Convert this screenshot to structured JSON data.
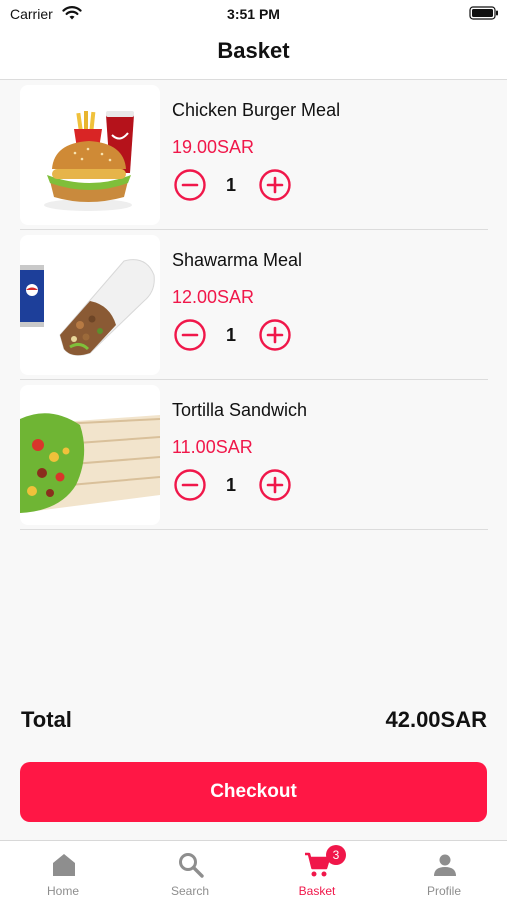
{
  "status_bar": {
    "carrier": "Carrier",
    "time": "3:51 PM"
  },
  "header": {
    "title": "Basket"
  },
  "items": [
    {
      "name": "Chicken Burger Meal",
      "price": "19.00SAR",
      "quantity": "1",
      "image": "chicken-burger-meal-photo"
    },
    {
      "name": "Shawarma Meal",
      "price": "12.00SAR",
      "quantity": "1",
      "image": "shawarma-meal-photo"
    },
    {
      "name": "Tortilla Sandwich",
      "price": "11.00SAR",
      "quantity": "1",
      "image": "tortilla-sandwich-photo"
    }
  ],
  "summary": {
    "total_label": "Total",
    "total_value": "42.00SAR"
  },
  "checkout": {
    "label": "Checkout"
  },
  "tab_bar": {
    "tabs": [
      {
        "label": "Home",
        "icon": "home-icon",
        "active": false
      },
      {
        "label": "Search",
        "icon": "search-icon",
        "active": false
      },
      {
        "label": "Basket",
        "icon": "cart-icon",
        "active": true,
        "badge": "3"
      },
      {
        "label": "Profile",
        "icon": "person-icon",
        "active": false
      }
    ]
  },
  "colors": {
    "accent": "#f0174a",
    "button": "#ff1745",
    "inactive_tab": "#8e8e8e",
    "background": "#f8f8f8"
  }
}
